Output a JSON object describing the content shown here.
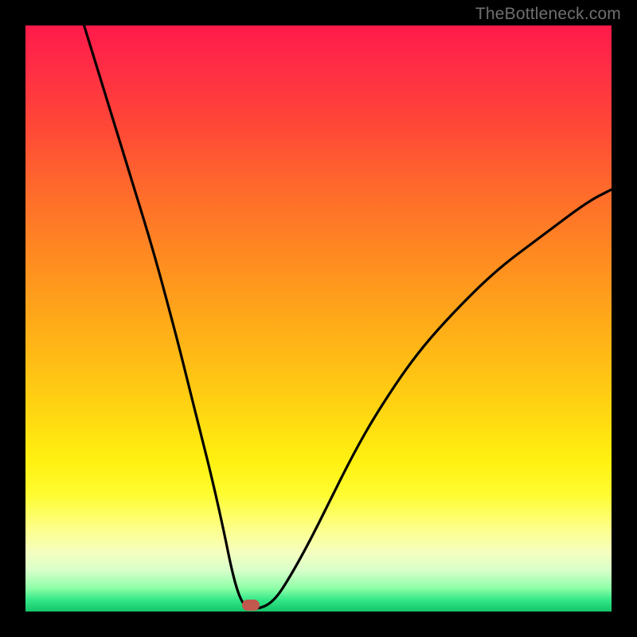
{
  "watermark": "TheBottleneck.com",
  "marker": {
    "x_pct": 38.5,
    "y_pct": 98.9
  },
  "colors": {
    "frame": "#000000",
    "curve": "#000000",
    "marker": "#c1584e",
    "watermark": "#6f6f6f",
    "gradient_top": "#ff1a4a",
    "gradient_bottom": "#14c46a"
  },
  "chart_data": {
    "type": "line",
    "title": "",
    "xlabel": "",
    "ylabel": "",
    "xlim": [
      0,
      100
    ],
    "ylim": [
      0,
      100
    ],
    "grid": false,
    "legend": false,
    "series": [
      {
        "name": "bottleneck-curve",
        "x": [
          10,
          14,
          18,
          22,
          26,
          28,
          30,
          32,
          34,
          35,
          36,
          37,
          38,
          40,
          42,
          44,
          48,
          52,
          56,
          60,
          66,
          72,
          80,
          88,
          96,
          100
        ],
        "y": [
          100,
          87,
          74,
          61,
          46,
          38,
          30,
          22,
          13,
          8,
          4,
          1.5,
          0.5,
          0.5,
          1.5,
          4,
          11,
          19,
          27,
          34,
          43,
          50,
          58,
          64,
          70,
          72
        ]
      }
    ],
    "annotations": [
      {
        "name": "bottleneck-marker",
        "x": 38.5,
        "y": 1.1
      }
    ],
    "notes": "Axes are unlabeled in the source image; x and y expressed as percentages of the plot area. Values estimated from pixel positions."
  }
}
